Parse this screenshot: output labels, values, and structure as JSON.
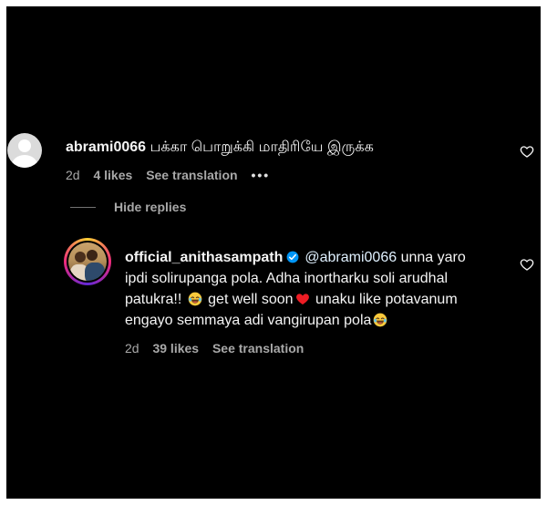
{
  "comment": {
    "username": "abrami0066",
    "text": "பக்கா பொறுக்கி மாதிரியே இருக்க",
    "time": "2d",
    "likes": "4 likes",
    "translate": "See translation",
    "more": "•••"
  },
  "replies_toggle": {
    "label": "Hide replies"
  },
  "reply": {
    "username": "official_anithasampath",
    "mention": "@abrami0066",
    "text_part1": " unna yaro ipdi solirupanga pola. Adha inortharku soli arudhal patukra!! ",
    "text_part2": " get well soon",
    "text_part3": " unaku like potavanum engayo semmaya adi vangirupan pola",
    "time": "2d",
    "likes": "39 likes",
    "translate": "See translation"
  },
  "colors": {
    "background": "#000000",
    "text": "#f5f5f5",
    "muted": "#a8a8a8",
    "mention": "#e0f1ff",
    "verified": "#0095f6",
    "heart_red": "#ed1c24"
  }
}
